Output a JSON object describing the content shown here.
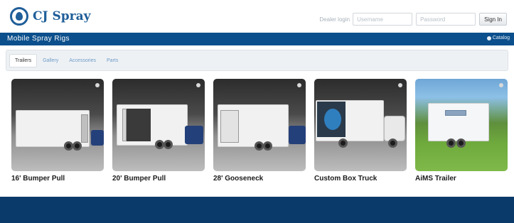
{
  "header": {
    "logo_text": "CJ Spray",
    "login_label": "Dealer login",
    "username_placeholder": "Username",
    "password_placeholder": "Password",
    "signin_label": "Sign In"
  },
  "titlebar": {
    "title": "Mobile Spray Rigs",
    "catalog_label": "Catalog"
  },
  "tabs": [
    {
      "label": "Trailers",
      "active": true
    },
    {
      "label": "Gallery",
      "active": false
    },
    {
      "label": "Accessories",
      "active": false
    },
    {
      "label": "Parts",
      "active": false
    }
  ],
  "products": [
    {
      "label": "16' Bumper Pull"
    },
    {
      "label": "20' Bumper Pull"
    },
    {
      "label": "28' Gooseneck"
    },
    {
      "label": "Custom Box Truck"
    },
    {
      "label": "AiMS Trailer"
    }
  ],
  "colors": {
    "brand_blue": "#0b4f8c",
    "footer_blue": "#0a3a6a",
    "tab_link": "#6d9cc9"
  }
}
